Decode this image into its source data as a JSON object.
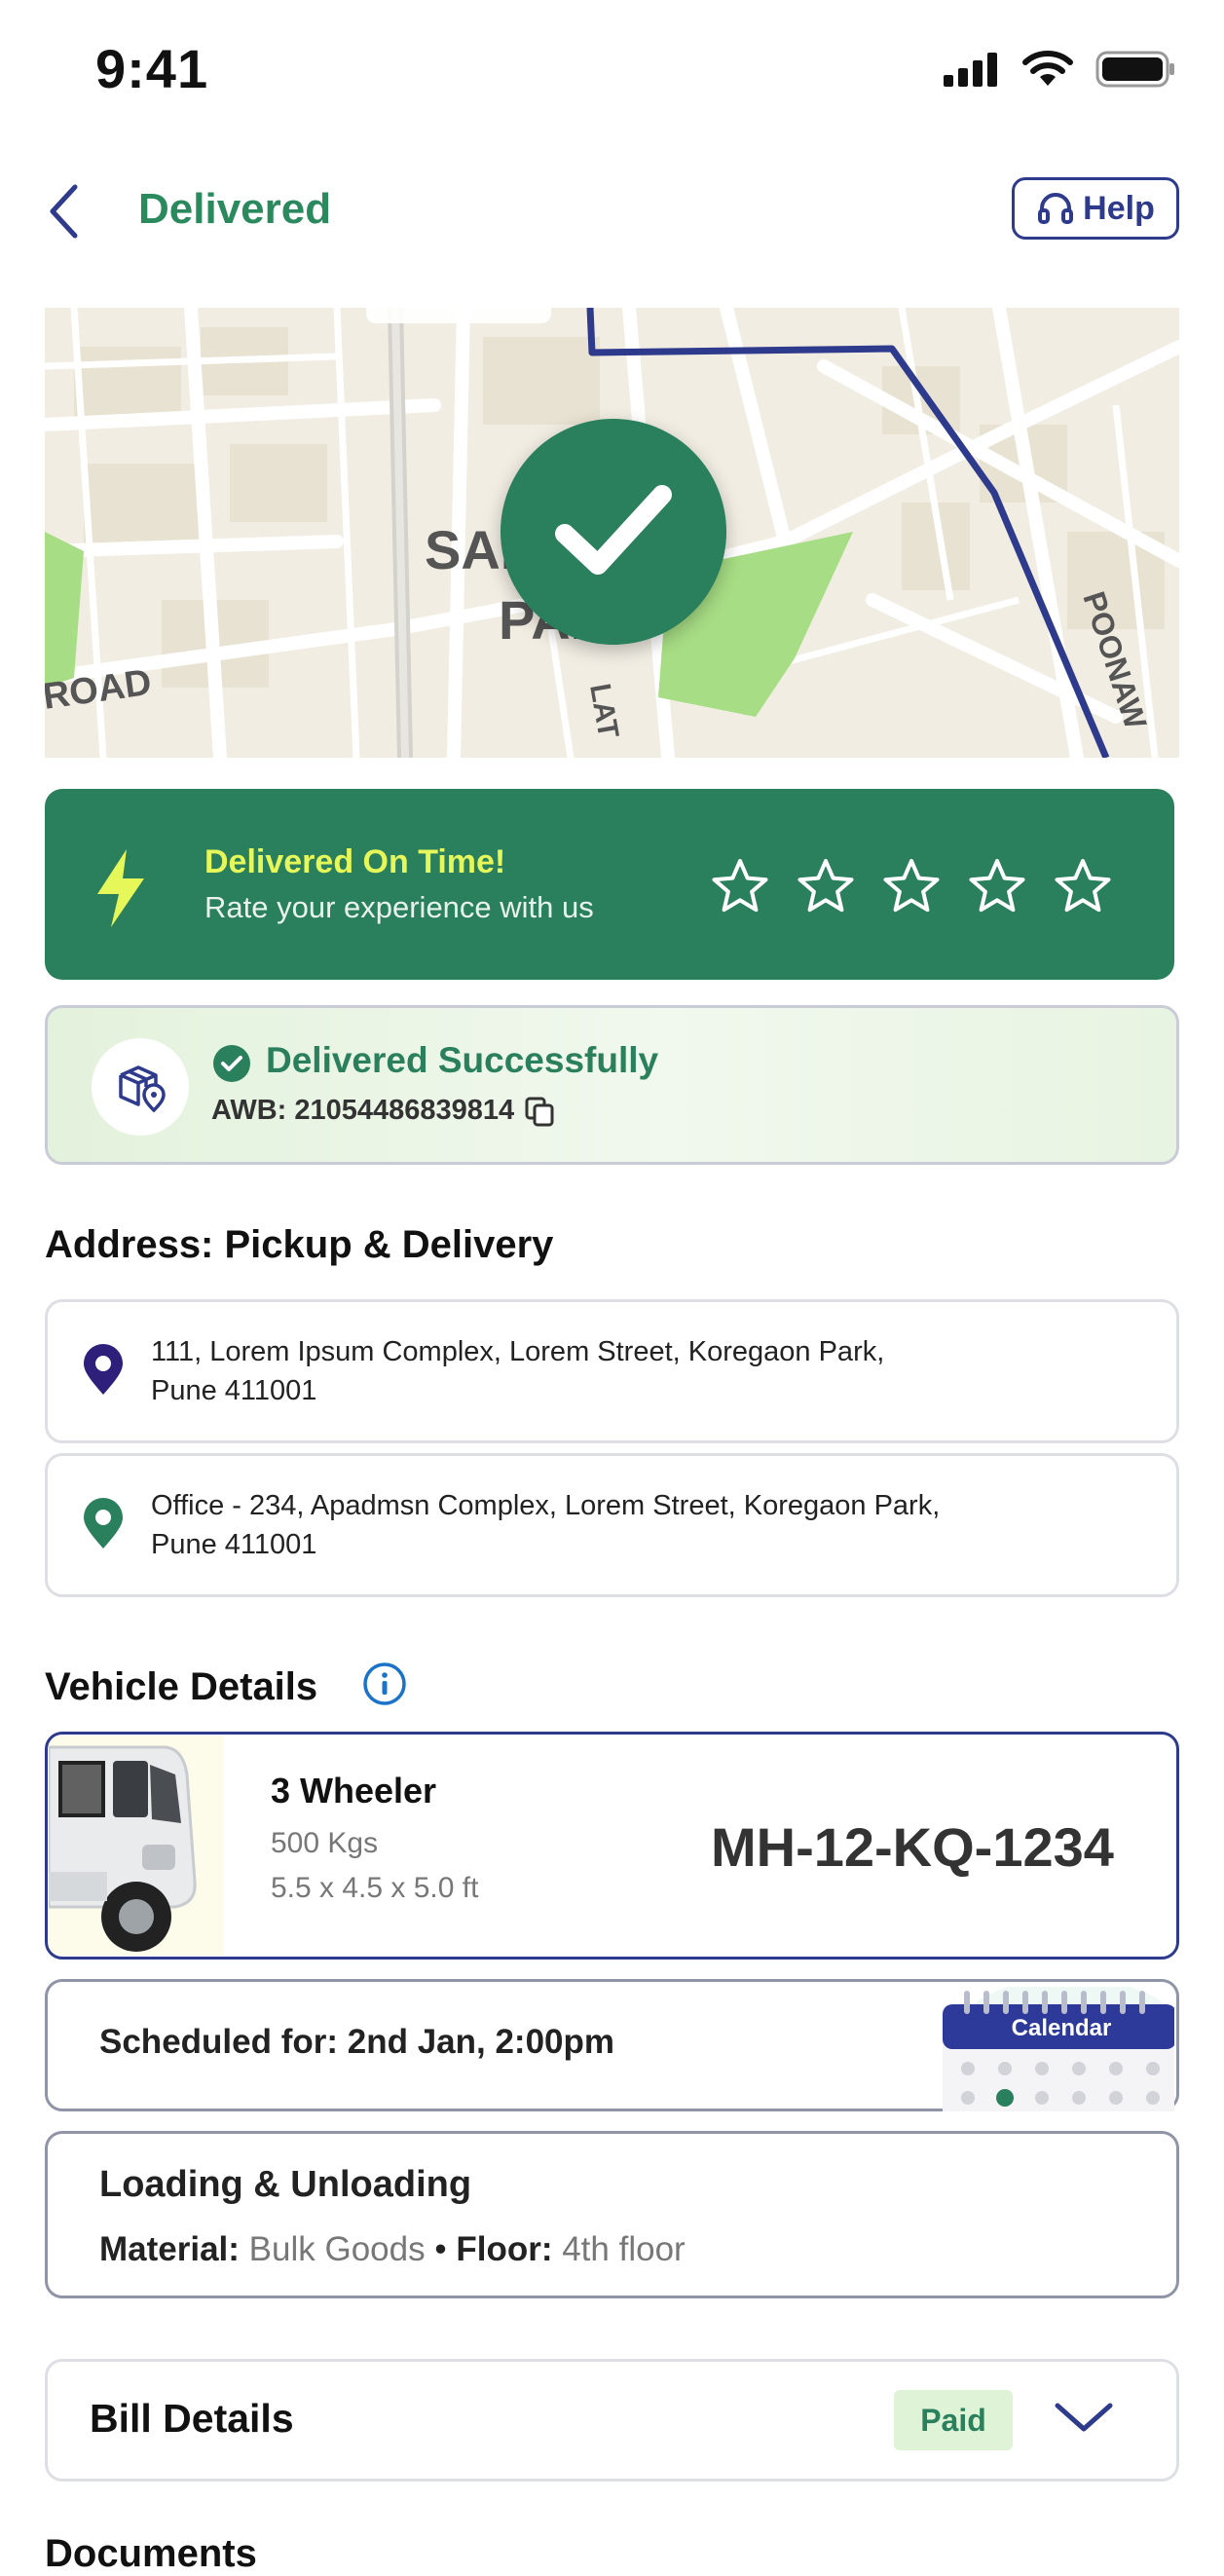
{
  "status_bar": {
    "time": "9:41"
  },
  "header": {
    "title": "Delivered",
    "help_label": "Help"
  },
  "map": {
    "labels": [
      "SAL",
      "PARK",
      "ROAD",
      "LAT",
      "POONAW"
    ],
    "route_color": "#2e3a8c"
  },
  "banner": {
    "title": "Delivered On Time!",
    "subtitle": "Rate your experience with us",
    "rating": {
      "max": 5,
      "value": 0
    }
  },
  "delivery_status": {
    "title": "Delivered Successfully",
    "awb_label": "AWB:",
    "awb_value": "21054486839814"
  },
  "address": {
    "section_title": "Address: Pickup & Delivery",
    "pickup": "111, Lorem Ipsum Complex, Lorem Street, Koregaon Park, Pune 411001",
    "delivery": "Office - 234, Apadmsn Complex, Lorem Street, Koregaon Park, Pune 411001"
  },
  "vehicle": {
    "section_title": "Vehicle Details",
    "name": "3 Wheeler",
    "weight": "500 Kgs",
    "dimensions": "5.5 x 4.5 x 5.0 ft",
    "plate": "MH-12-KQ-1234"
  },
  "schedule": {
    "text": "Scheduled for: 2nd Jan, 2:00pm",
    "calendar_label": "Calendar"
  },
  "loading": {
    "title": "Loading & Unloading",
    "material_label": "Material:",
    "material_value": "Bulk Goods",
    "separator": "•",
    "floor_label": "Floor:",
    "floor_value": "4th floor"
  },
  "bill": {
    "title": "Bill Details",
    "status": "Paid"
  },
  "documents": {
    "title": "Documents"
  },
  "colors": {
    "brand_green": "#2a7f5c",
    "accent_navy": "#2e3a8c",
    "highlight_yellow": "#e6f75a"
  }
}
